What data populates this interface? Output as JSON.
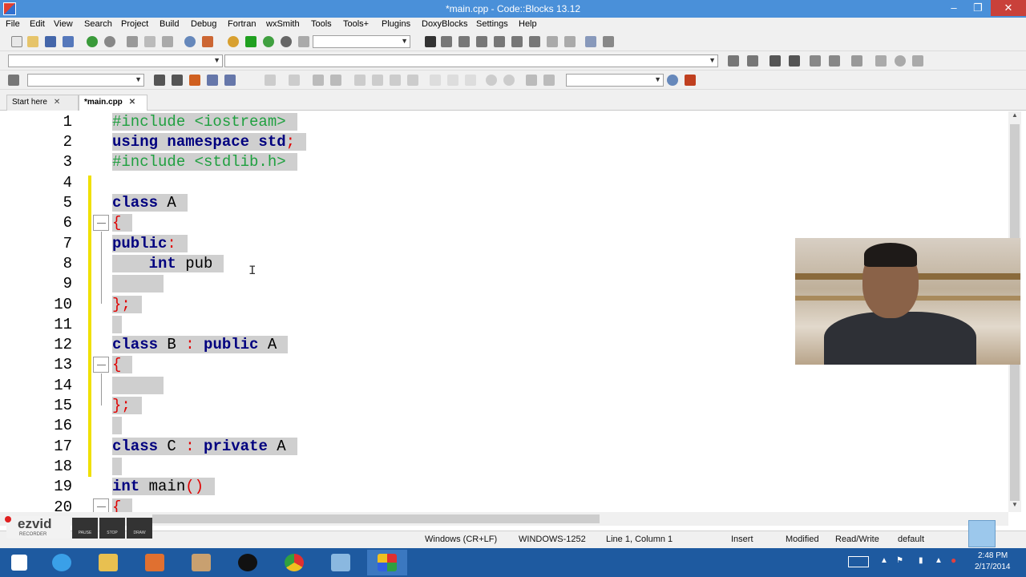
{
  "window": {
    "title": "*main.cpp - Code::Blocks 13.12"
  },
  "menu": [
    "File",
    "Edit",
    "View",
    "Search",
    "Project",
    "Build",
    "Debug",
    "Fortran",
    "wxSmith",
    "Tools",
    "Tools+",
    "Plugins",
    "DoxyBlocks",
    "Settings",
    "Help"
  ],
  "tabs": [
    {
      "label": "Start here"
    },
    {
      "label": "*main.cpp"
    }
  ],
  "code": {
    "line_numbers": [
      "1",
      "2",
      "3",
      "4",
      "5",
      "6",
      "7",
      "8",
      "9",
      "10",
      "11",
      "12",
      "13",
      "14",
      "15",
      "16",
      "17",
      "18",
      "19",
      "20"
    ],
    "l1": "#include <iostream>",
    "l2a": "using namespace std",
    "l2b": ";",
    "l3": "#include <stdlib.h>",
    "l5a": "class",
    "l5b": " A",
    "l6": "{",
    "l7a": "public",
    "l7b": ":",
    "l8a": "    int",
    "l8b": " pub",
    "l10": "};",
    "l12a": "class",
    "l12b": " B ",
    "l12c": ":",
    "l12d": " public",
    "l12e": " A",
    "l13": "{",
    "l15": "};",
    "l17a": "class",
    "l17b": " C ",
    "l17c": ":",
    "l17d": " private",
    "l17e": " A",
    "l19a": "int",
    "l19b": " main",
    "l19c": "()",
    "l20": "{"
  },
  "status": {
    "eol": "Windows (CR+LF)",
    "encoding": "WINDOWS-1252",
    "position": "Line 1, Column 1",
    "mode": "Insert",
    "modified": "Modified",
    "access": "Read/Write",
    "lang": "default"
  },
  "recorder": {
    "brand": "ezvid",
    "sub": "RECORDER",
    "pause": "PAUSE",
    "stop": "STOP",
    "draw": "DRAW"
  },
  "clock": {
    "time": "2:48 PM",
    "date": "2/17/2014"
  },
  "colors": {
    "titlebar": "#4a90d9",
    "taskbar": "#1e5aa0",
    "keyword": "#00007f",
    "preprocessor": "#20a040",
    "brace": "#e00000",
    "selection": "#cfcfcf"
  }
}
